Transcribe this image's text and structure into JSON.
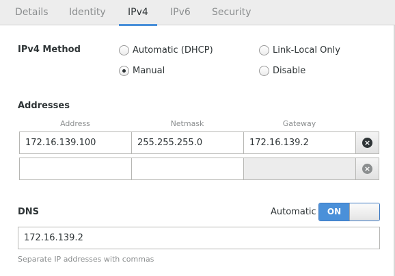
{
  "tabs": [
    {
      "label": "Details"
    },
    {
      "label": "Identity"
    },
    {
      "label": "IPv4"
    },
    {
      "label": "IPv6"
    },
    {
      "label": "Security"
    }
  ],
  "active_tab": "IPv4",
  "ipv4_method": {
    "label": "IPv4 Method",
    "options": [
      {
        "label": "Automatic (DHCP)",
        "checked": false
      },
      {
        "label": "Link-Local Only",
        "checked": false
      },
      {
        "label": "Manual",
        "checked": true
      },
      {
        "label": "Disable",
        "checked": false
      }
    ]
  },
  "addresses": {
    "label": "Addresses",
    "columns": [
      "Address",
      "Netmask",
      "Gateway"
    ],
    "rows": [
      {
        "address": "172.16.139.100",
        "netmask": "255.255.255.0",
        "gateway": "172.16.139.2"
      },
      {
        "address": "",
        "netmask": "",
        "gateway": ""
      }
    ]
  },
  "dns": {
    "label": "DNS",
    "automatic_label": "Automatic",
    "switch_label": "ON",
    "switch_on": true,
    "value": "172.16.139.2",
    "hint": "Separate IP addresses with commas"
  },
  "colors": {
    "accent": "#4a90d9",
    "text": "#2e3436",
    "muted": "#8b8e8f"
  },
  "icons": {
    "delete": "circle-x-icon"
  }
}
